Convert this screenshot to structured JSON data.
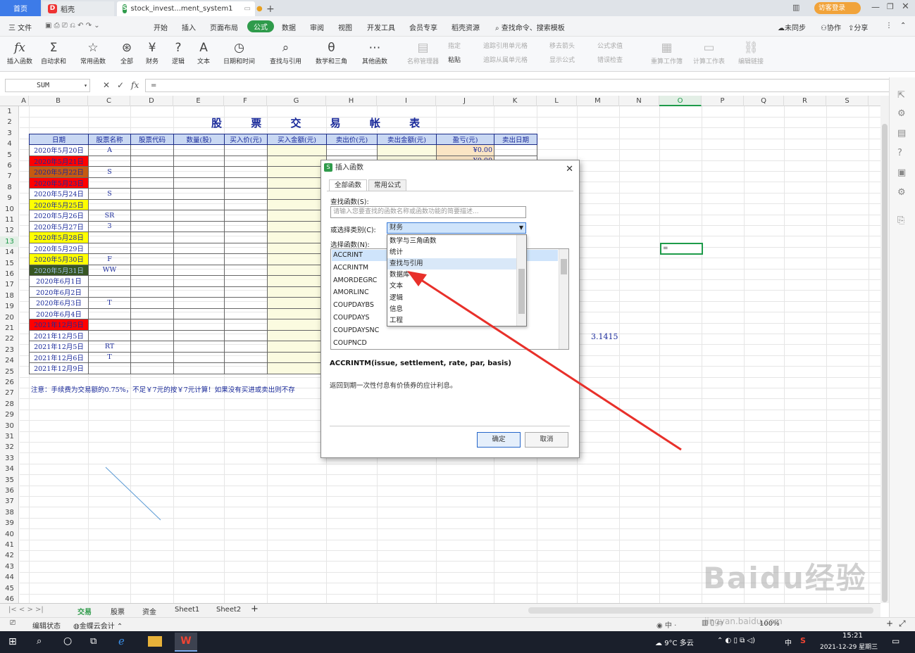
{
  "tabs": {
    "home": "首页",
    "daoke": "稻壳",
    "doc": "stock_invest...ment_system1",
    "newtab": "+",
    "guest": "访客登录"
  },
  "menu": [
    "三 文件",
    "开始",
    "插入",
    "页面布局",
    "公式",
    "数据",
    "审阅",
    "视图",
    "开发工具",
    "会员专享",
    "稻壳资源",
    "查找命令、搜索模板",
    "未同步",
    "协作",
    "分享"
  ],
  "ribbon": {
    "insert_fn": "插入函数",
    "autosum": "自动求和",
    "common": "常用函数",
    "all": "全部",
    "finance": "财务",
    "logic": "逻辑",
    "text": "文本",
    "datetime": "日期和时间",
    "lookup": "查找与引用",
    "math": "数学和三角",
    "other": "其他函数",
    "name_mgr": "名称管理器",
    "specify": "指定",
    "paste": "粘贴",
    "trace_prec": "追踪引用单元格",
    "trace_dep": "追踪从属单元格",
    "remove_arrows": "移去箭头",
    "show_formula": "显示公式",
    "eval": "公式求值",
    "error_check": "错误检查",
    "recalc": "重算工作簿",
    "calc_sheet": "计算工作表",
    "edit_links": "编辑链接"
  },
  "formula_bar": {
    "name_box": "SUM",
    "content": "="
  },
  "columns": [
    "A",
    "B",
    "C",
    "D",
    "E",
    "F",
    "G",
    "H",
    "I",
    "J",
    "K",
    "L",
    "M",
    "N",
    "O",
    "P",
    "Q",
    "R",
    "S"
  ],
  "sheet": {
    "title": "股 票 交 易 帐 表",
    "headers": [
      "日期",
      "股票名称",
      "股票代码",
      "数量(股)",
      "买入价(元)",
      "买入金额(元)",
      "卖出价(元)",
      "卖出金额(元)",
      "盈亏(元)",
      "卖出日期"
    ],
    "rows": [
      {
        "date": "2020年5月20日",
        "name": "A",
        "pl": "¥0.00",
        "bg": "#ffffff"
      },
      {
        "date": "2020年5月21日",
        "name": "",
        "pl": "¥0.00",
        "bg": "#ff0000"
      },
      {
        "date": "2020年5月22日",
        "name": "S",
        "pl": "",
        "bg": "#c55a11"
      },
      {
        "date": "2020年5月23日",
        "name": "",
        "pl": "",
        "bg": "#ff0000"
      },
      {
        "date": "2020年5月24日",
        "name": "S",
        "pl": "",
        "bg": "#ffffff"
      },
      {
        "date": "2020年5月25日",
        "name": "",
        "pl": "",
        "bg": "#ffff00"
      },
      {
        "date": "2020年5月26日",
        "name": "SR",
        "pl": "",
        "bg": "#ffffff"
      },
      {
        "date": "2020年5月27日",
        "name": "3",
        "pl": "",
        "bg": "#ffffff"
      },
      {
        "date": "2020年5月28日",
        "name": "",
        "pl": "",
        "bg": "#ffff00"
      },
      {
        "date": "2020年5月29日",
        "name": "",
        "pl": "",
        "bg": "#ffffff"
      },
      {
        "date": "2020年5月30日",
        "name": "F",
        "pl": "",
        "bg": "#ffff00"
      },
      {
        "date": "2020年5月31日",
        "name": "WW",
        "pl": "",
        "bg": "#375623"
      },
      {
        "date": "2020年6月1日",
        "name": "",
        "pl": "",
        "bg": "#ffffff"
      },
      {
        "date": "2020年6月2日",
        "name": "",
        "pl": "",
        "bg": "#ffffff"
      },
      {
        "date": "2020年6月3日",
        "name": "T",
        "pl": "",
        "bg": "#ffffff"
      },
      {
        "date": "2020年6月4日",
        "name": "",
        "pl": "",
        "bg": "#ffffff"
      },
      {
        "date": "2021年12月5日",
        "name": "",
        "pl": "",
        "bg": "#ff0000"
      },
      {
        "date": "2021年12月5日",
        "name": "",
        "pl": "",
        "bg": "#ffffff"
      },
      {
        "date": "2021年12月5日",
        "name": "RT",
        "pl": "",
        "bg": "#ffffff"
      },
      {
        "date": "2021年12月6日",
        "name": "T",
        "pl": "",
        "bg": "#ffffff"
      },
      {
        "date": "2021年12月9日",
        "name": "",
        "pl": "",
        "bg": "#ffffff"
      }
    ],
    "note": "注意：手续费为交易额的0.75%，不足￥7元的按￥7元计算！如果没有买进或卖出则不存",
    "pi": "3.1415",
    "o13": "="
  },
  "dialog": {
    "title": "插入函数",
    "tab_all": "全部函数",
    "tab_common": "常用公式",
    "search_label": "查找函数(S):",
    "search_placeholder": "请输入您要查找的函数名称或函数功能的简要描述...",
    "category_label": "或选择类别(C):",
    "category": "财务",
    "select_label": "选择函数(N):",
    "functions": [
      "ACCRINT",
      "ACCRINTM",
      "AMORDEGRC",
      "AMORLINC",
      "COUPDAYBS",
      "COUPDAYS",
      "COUPDAYSNC",
      "COUPNCD"
    ],
    "dropdown": [
      "数学与三角函数",
      "统计",
      "查找与引用",
      "数据库",
      "文本",
      "逻辑",
      "信息",
      "工程"
    ],
    "signature": "ACCRINTM(issue, settlement, rate, par, basis)",
    "description": "返回到期一次性付息有价债券的应计利息。",
    "ok": "确定",
    "cancel": "取消"
  },
  "sheet_tabs": [
    "交易",
    "股票",
    "资金",
    "Sheet1",
    "Sheet2"
  ],
  "status": {
    "edit": "编辑状态",
    "cloud": "金蝶云会计",
    "zoom": "100%"
  },
  "taskbar": {
    "weather": "9°C 多云",
    "time": "15:21",
    "date": "2021-12-29 星期三",
    "ime": "中"
  },
  "watermark": {
    "main": "Baidu经验",
    "url": "jingyan.baidu.com"
  },
  "colors": {
    "accent": "#2f9b4b",
    "header_bg": "#c9d8f3",
    "arrow": "#e8302a"
  }
}
